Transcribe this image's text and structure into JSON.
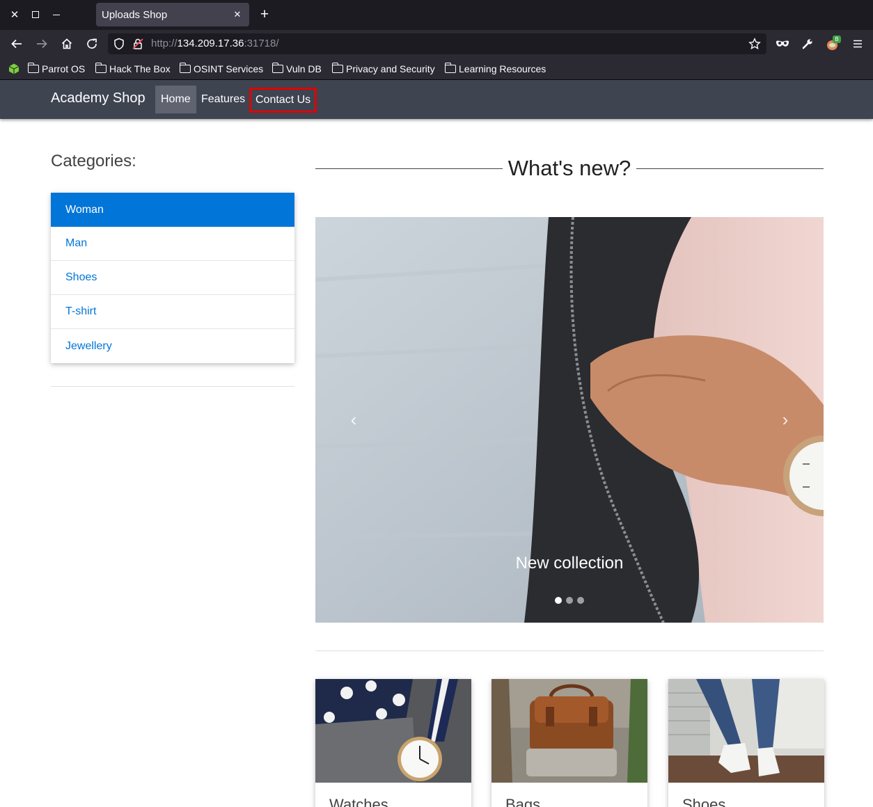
{
  "browser": {
    "tab_title": "Uploads Shop",
    "url_scheme": "http://",
    "url_host": "134.209.17.36",
    "url_port": ":31718/",
    "bookmarks": [
      "Parrot OS",
      "Hack The Box",
      "OSINT Services",
      "Vuln DB",
      "Privacy and Security",
      "Learning Resources"
    ],
    "extension_badge": "B"
  },
  "site": {
    "brand": "Academy Shop",
    "nav": [
      "Home",
      "Features",
      "Contact Us"
    ],
    "categories_title": "Categories:",
    "categories": [
      "Woman",
      "Man",
      "Shoes",
      "T-shirt",
      "Jewellery"
    ],
    "whats_new": "What's new?",
    "carousel_caption": "New collection",
    "carousel_slide_count": 3,
    "carousel_active_index": 0,
    "cards": [
      "Watches",
      "Bags",
      "Shoes"
    ]
  },
  "colors": {
    "nav_bg": "#3f4451",
    "primary": "#0275d8",
    "highlight_box": "#e00000"
  }
}
